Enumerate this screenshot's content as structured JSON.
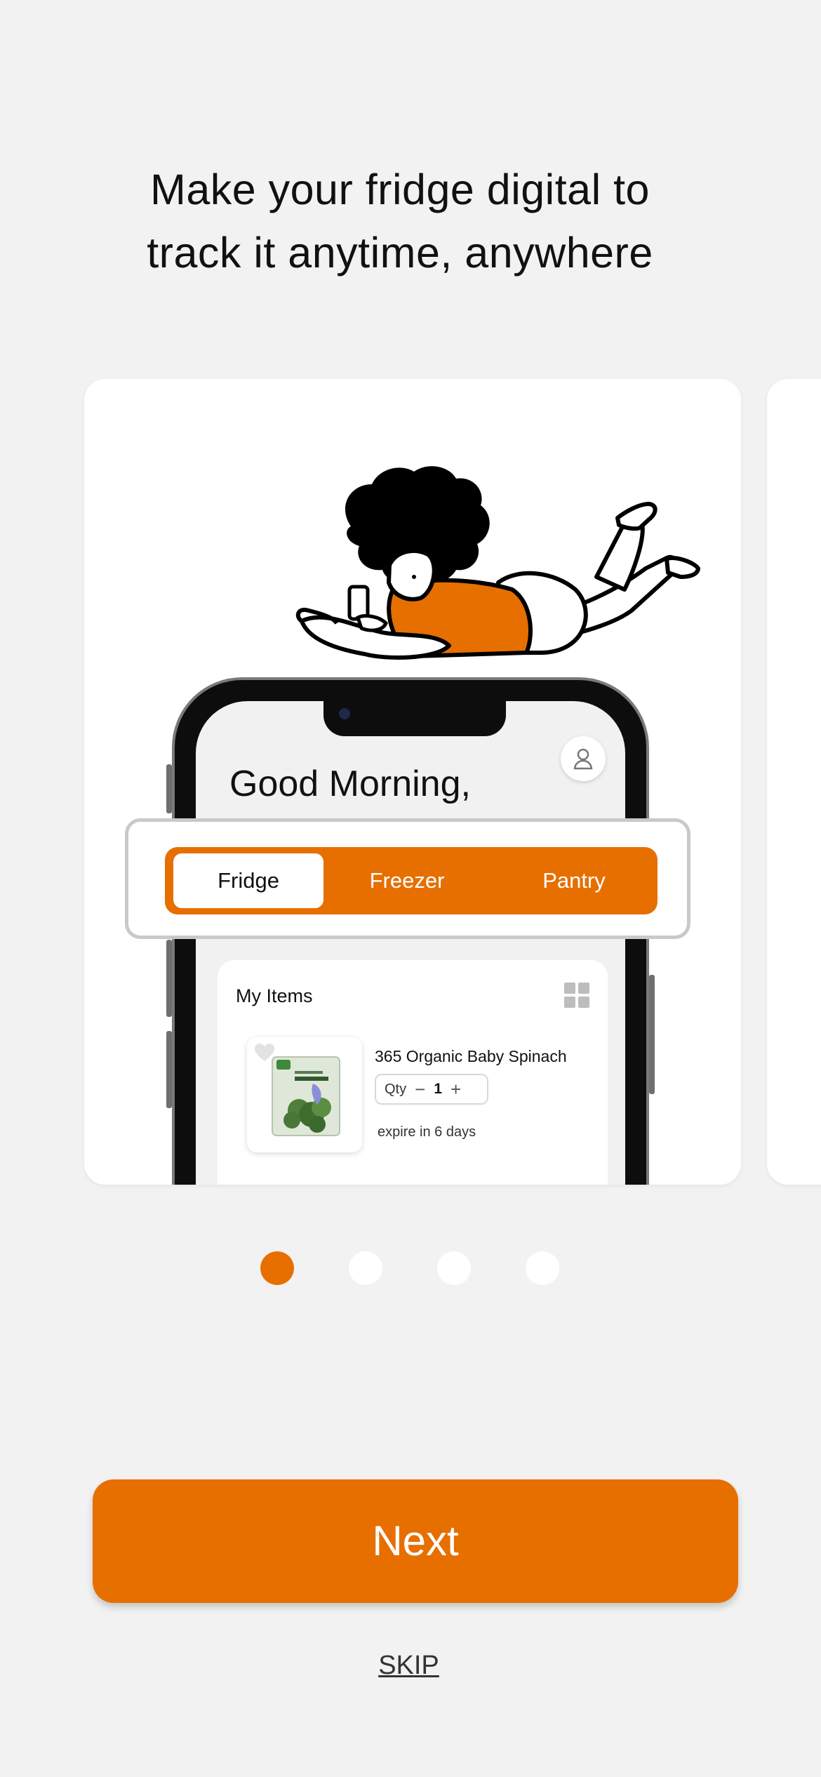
{
  "headline": {
    "line1": "Make your fridge digital to",
    "line2": "track it anytime, anywhere"
  },
  "mockup": {
    "greeting": "Good Morning,",
    "tabs": [
      {
        "label": "Fridge",
        "active": true
      },
      {
        "label": "Freezer",
        "active": false
      },
      {
        "label": "Pantry",
        "active": false
      }
    ],
    "items_title": "My Items",
    "item": {
      "name": "365 Organic Baby Spinach",
      "qty_label": "Qty",
      "qty_value": "1",
      "expiry": "expire in 6 days"
    }
  },
  "pager": {
    "total": 4,
    "active_index": 0
  },
  "actions": {
    "next_label": "Next",
    "skip_label": "SKIP"
  },
  "colors": {
    "accent": "#e66f00",
    "background": "#f2f2f2",
    "dot_inactive": "#ffffff"
  }
}
